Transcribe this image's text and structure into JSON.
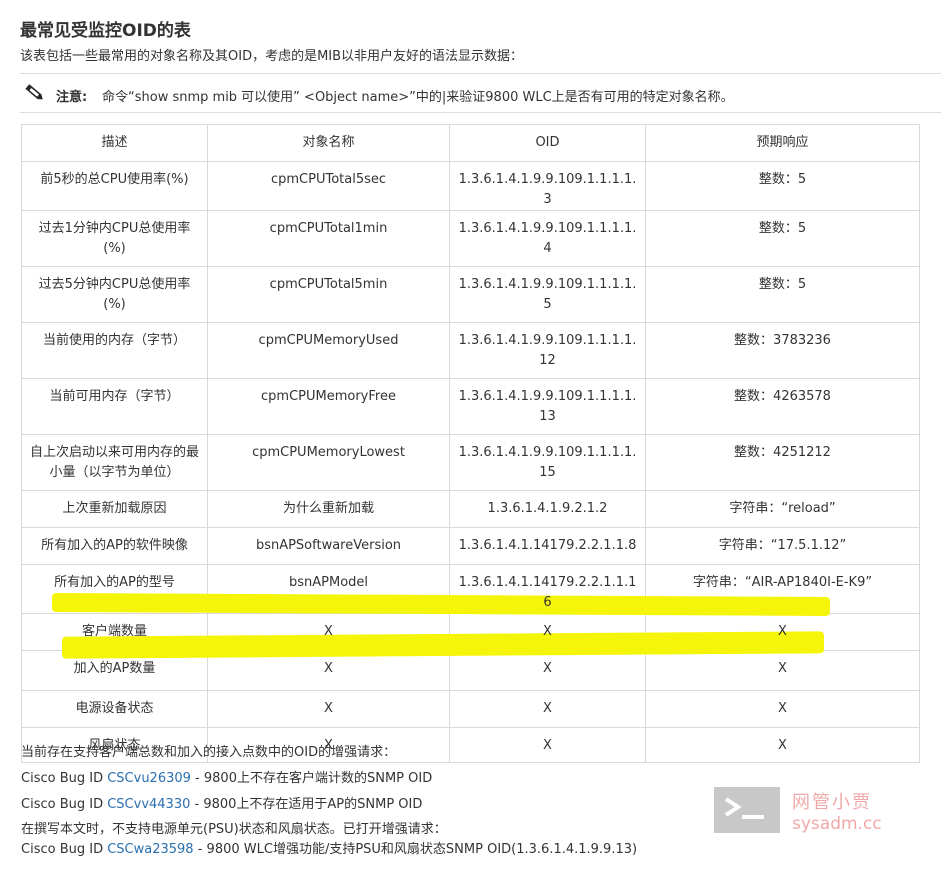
{
  "title": "最常见受监控OID的表",
  "intro": "该表包括一些最常用的对象名称及其OID，考虑的是MIB以非用户友好的语法显示数据：",
  "note": {
    "label": "注意:",
    "text": "命令“show snmp mib 可以使用” <Object name>”中的|来验证9800 WLC上是否有可用的特定对象名称。"
  },
  "table": {
    "headers": [
      "描述",
      "对象名称",
      "OID",
      "预期响应"
    ],
    "rows": [
      [
        "前5秒的总CPU使用率(%)",
        "cpmCPUTotal5sec",
        "1.3.6.1.4.1.9.9.109.1.1.1.1.3",
        "整数：5"
      ],
      [
        "过去1分钟内CPU总使用率(%)",
        "cpmCPUTotal1min",
        "1.3.6.1.4.1.9.9.109.1.1.1.1.4",
        "整数：5"
      ],
      [
        "过去5分钟内CPU总使用率(%)",
        "cpmCPUTotal5min",
        "1.3.6.1.4.1.9.9.109.1.1.1.1.5",
        "整数：5"
      ],
      [
        "当前使用的内存（字节）",
        "cpmCPUMemoryUsed",
        "1.3.6.1.4.1.9.9.109.1.1.1.1.12",
        "整数：3783236"
      ],
      [
        "当前可用内存（字节）",
        "cpmCPUMemoryFree",
        "1.3.6.1.4.1.9.9.109.1.1.1.1.13",
        "整数：4263578"
      ],
      [
        "自上次启动以来可用内存的最小量（以字节为单位）",
        "cpmCPUMemoryLowest",
        "1.3.6.1.4.1.9.9.109.1.1.1.1.15",
        "整数：4251212"
      ],
      [
        "上次重新加载原因",
        "为什么重新加载",
        "1.3.6.1.4.1.9.2.1.2",
        "字符串：“reload”"
      ],
      [
        "所有加入的AP的软件映像",
        "bsnAPSoftwareVersion",
        "1.3.6.1.4.1.14179.2.2.1.1.8",
        "字符串：“17.5.1.12”"
      ],
      [
        "所有加入的AP的型号",
        "bsnAPModel",
        "1.3.6.1.4.1.14179.2.2.1.1.16",
        "字符串：“AIR-AP1840I-E-K9”"
      ],
      [
        "客户端数量",
        "X",
        "X",
        "X"
      ],
      [
        "加入的AP数量",
        "X",
        "X",
        "X"
      ],
      [
        "电源设备状态",
        "X",
        "X",
        "X"
      ],
      [
        "风扇状态",
        "X",
        "X",
        "X"
      ]
    ]
  },
  "footer": {
    "line1": "当前存在支持客户端总数和加入的接入点数中的OID的增强请求：",
    "bug1": {
      "prefix": "Cisco Bug ID ",
      "id": "CSCvu26309",
      "text": " - 9800上不存在客户端计数的SNMP OID"
    },
    "bug2": {
      "prefix": "Cisco Bug ID ",
      "id": "CSCvv44330",
      "text": " - 9800上不存在适用于AP的SNMP OID"
    },
    "line2": "在撰写本文时，不支持电源单元(PSU)状态和风扇状态。已打开增强请求：",
    "bug3": {
      "prefix": "Cisco Bug ID ",
      "id": "CSCwa23598",
      "text": " - 9800 WLC增强功能/支持PSU和风扇状态SNMP OID(1.3.6.1.4.1.9.9.13)"
    }
  },
  "watermark": {
    "cn": "网管小贾",
    "en": "sysadm.cc"
  },
  "colors": {
    "highlight": "#f5f50a",
    "link": "#2a6fb0",
    "border": "#d9d9d9"
  }
}
